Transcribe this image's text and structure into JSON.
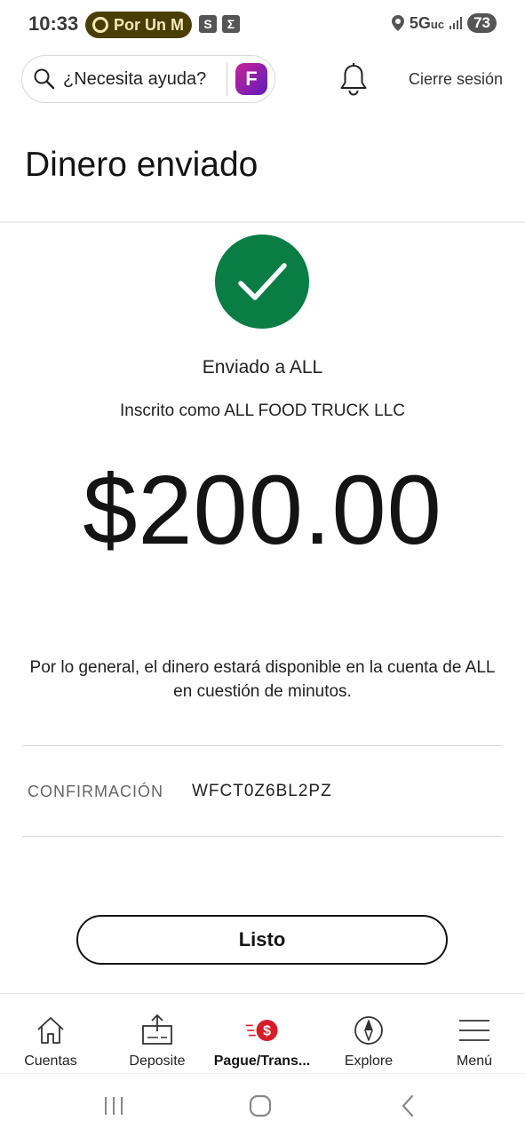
{
  "status_bar": {
    "time": "10:33",
    "pill_label": "Por Un M",
    "badge_s": "S",
    "badge_sigma": "Σ",
    "network": "5G",
    "network_suffix": "uc",
    "battery": "73"
  },
  "header": {
    "search_placeholder": "¿Necesita ayuda?",
    "assistant_letter": "F",
    "sign_out": "Cierre sesión"
  },
  "page": {
    "title": "Dinero enviado",
    "sent_to": "Enviado a ALL",
    "enrolled_as": "Inscrito como ALL FOOD TRUCK LLC",
    "amount": "$200.00",
    "availability_note": "Por lo general, el dinero estará disponible en la cuenta de ALL en cuestión de minutos.",
    "confirmation_label": "CONFIRMACIÓN",
    "confirmation_value": "WFCT0Z6BL2PZ",
    "done_button": "Listo"
  },
  "bottom_nav": {
    "items": [
      {
        "label": "Cuentas",
        "icon": "home-icon"
      },
      {
        "label": "Deposite",
        "icon": "deposit-icon"
      },
      {
        "label": "Pague/Trans...",
        "icon": "pay-transfer-icon",
        "active": true
      },
      {
        "label": "Explore",
        "icon": "compass-icon"
      },
      {
        "label": "Menú",
        "icon": "hamburger-menu-icon"
      }
    ]
  },
  "colors": {
    "success_green": "#0a7d45",
    "brand_red": "#d71e28",
    "text": "#141414"
  }
}
